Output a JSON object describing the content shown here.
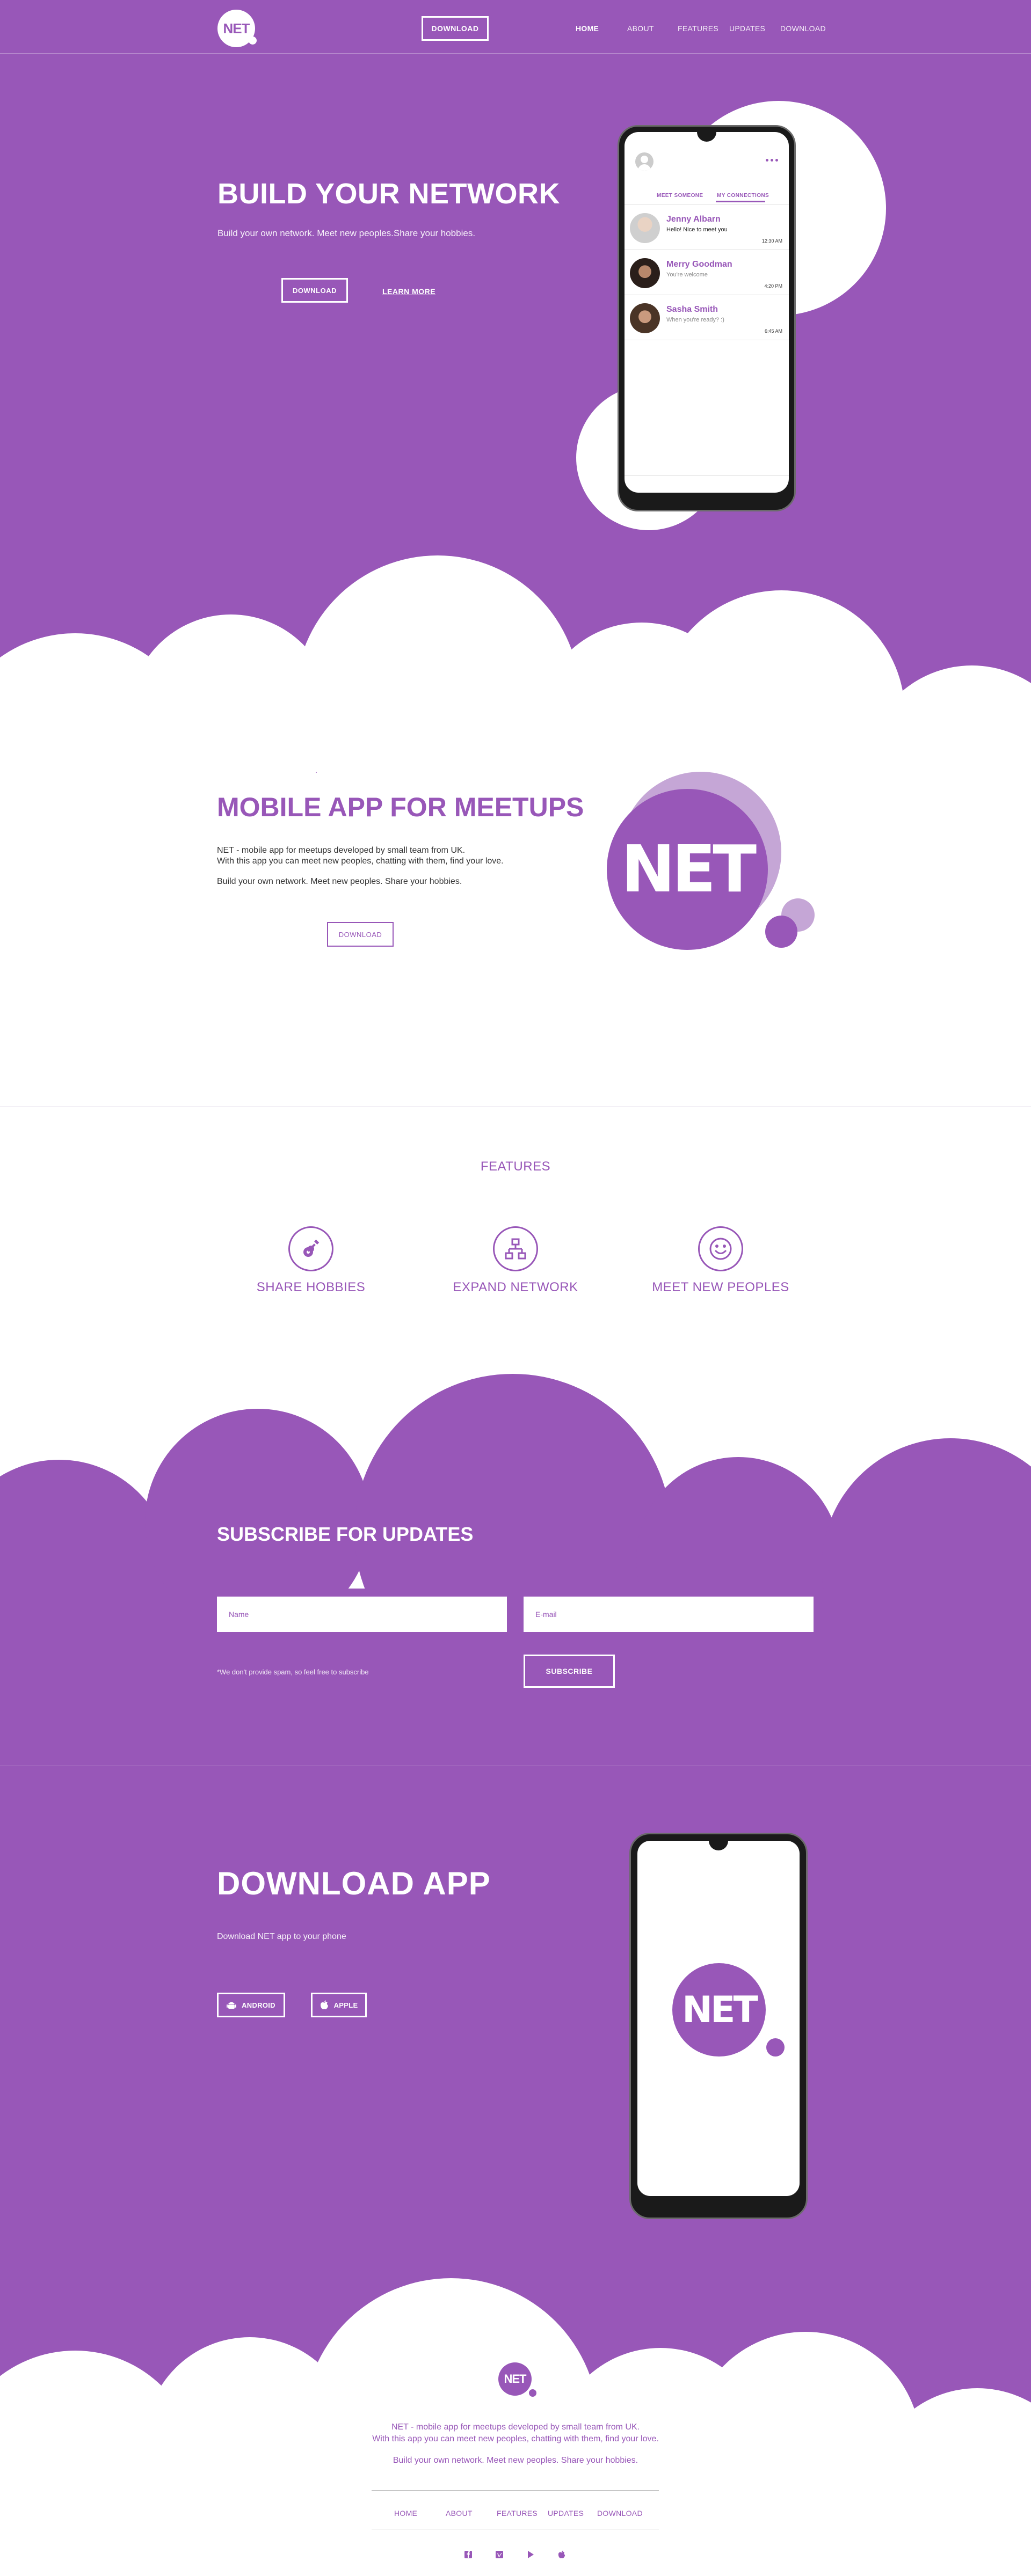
{
  "brand": {
    "logo": "NET",
    "accent": "#9857b8"
  },
  "header": {
    "download_label": "DOWNLOAD",
    "nav": [
      "HOME",
      "ABOUT",
      "FEATURES",
      "UPDATES",
      "DOWNLOAD"
    ]
  },
  "hero": {
    "title": "BUILD YOUR NETWORK",
    "subtitle": "Build your own network. Meet new peoples.Share your hobbies.",
    "download_label": "DOWNLOAD",
    "learn_more_label": "LEARN MORE"
  },
  "phone_app": {
    "tabs": [
      "MEET SOMEONE",
      "MY CONNECTIONS"
    ],
    "active_tab": "MY CONNECTIONS",
    "chats": [
      {
        "name": "Jenny Albarn",
        "message": "Hello! Nice to meet you",
        "time": "12:30 AM"
      },
      {
        "name": "Merry Goodman",
        "message": "You're welcome",
        "time": "4:20 PM"
      },
      {
        "name": "Sasha Smith",
        "message": "When you're ready? :)",
        "time": "6:45 AM"
      }
    ]
  },
  "about": {
    "title": "MOBILE APP FOR MEETUPS",
    "line1": "NET - mobile app for meetups developed by small team from UK.",
    "line2": "With this app you can meet new peoples, chatting with them, find your love.",
    "line3": "Build your own network. Meet new peoples. Share your hobbies.",
    "download_label": "DOWNLOAD",
    "logo_text": "NET"
  },
  "features": {
    "title": "FEATURES",
    "items": [
      {
        "label": "SHARE HOBBIES",
        "icon": "guitar-icon"
      },
      {
        "label": "EXPAND NETWORK",
        "icon": "network-icon"
      },
      {
        "label": "MEET NEW PEOPLES",
        "icon": "smile-icon"
      }
    ]
  },
  "subscribe": {
    "title": "SUBSCRIBE FOR UPDATES",
    "name_placeholder": "Name",
    "email_placeholder": "E-mail",
    "spam_note": "*We don't provide spam, so feel free to subscribe",
    "button_label": "SUBSCRIBE"
  },
  "download": {
    "title": "DOWNLOAD APP",
    "subtitle": "Download NET app to your phone",
    "android_label": "ANDROID",
    "apple_label": "APPLE",
    "phone_logo": "NET"
  },
  "footer": {
    "logo": "NET",
    "line1": "NET - mobile app for meetups developed by small team from UK.",
    "line2": "With this app you can meet new peoples, chatting with them, find your love.",
    "line3": "Build your own network. Meet new peoples. Share your hobbies.",
    "nav": [
      "HOME",
      "ABOUT",
      "FEATURES",
      "UPDATES",
      "DOWNLOAD"
    ],
    "social": [
      "facebook-icon",
      "vimeo-icon",
      "play-icon",
      "apple-icon"
    ]
  }
}
